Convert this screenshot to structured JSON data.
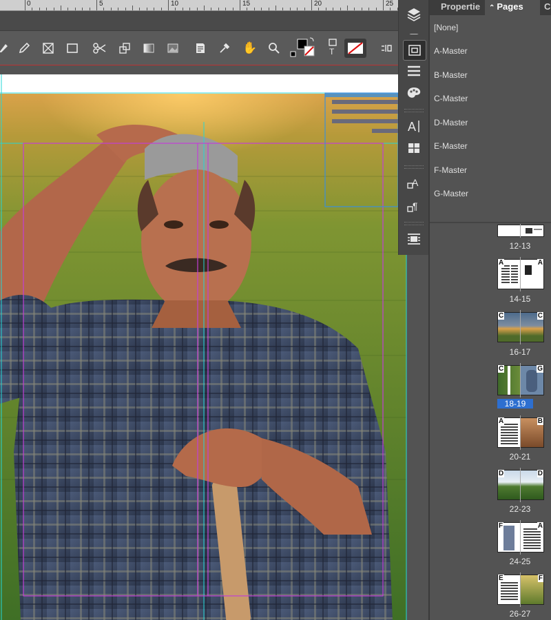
{
  "ruler": {
    "labels": [
      "0",
      "5",
      "10",
      "15",
      "20",
      "25"
    ]
  },
  "toolbar": {
    "tools": [
      "direct-select-icon",
      "pencil-icon",
      "rectangle-frame-icon",
      "rectangle-icon",
      "scissors-icon",
      "free-transform-icon",
      "gradient-swatch-icon",
      "gradient-feather-icon",
      "note-icon",
      "eyedropper-icon",
      "hand-icon",
      "zoom-icon",
      "fill-stroke-icon",
      "format-affects-icon",
      "apply-none-icon",
      "view-mode-icon",
      "screen-mode-icon"
    ]
  },
  "minibar": {
    "icons": [
      "layers-icon",
      "links-icon",
      "stroke-icon",
      "swatches-icon",
      "character-styles-icon",
      "paragraph-table-icon",
      "object-styles-icon",
      "paragraph-styles-icon",
      "text-wrap-icon"
    ]
  },
  "panel": {
    "tabs": [
      "Propertie",
      "Pages",
      "Co"
    ],
    "masters": [
      "[None]",
      "A-Master",
      "B-Master",
      "C-Master",
      "D-Master",
      "E-Master",
      "F-Master",
      "G-Master"
    ],
    "spreads": [
      {
        "label": "12-13",
        "left_master": "",
        "right_master": ""
      },
      {
        "label": "14-15",
        "left_master": "A",
        "right_master": "A"
      },
      {
        "label": "16-17",
        "left_master": "C",
        "right_master": "C"
      },
      {
        "label": "18-19",
        "left_master": "C",
        "right_master": "G",
        "selected": true
      },
      {
        "label": "20-21",
        "left_master": "A",
        "right_master": "B"
      },
      {
        "label": "22-23",
        "left_master": "D",
        "right_master": "D"
      },
      {
        "label": "24-25",
        "left_master": "F",
        "right_master": "A"
      },
      {
        "label": "26-27",
        "left_master": "E",
        "right_master": "F"
      }
    ]
  },
  "colors": {
    "guide_magenta": "#c23fd6",
    "guide_cyan": "#23d7d7",
    "selection_blue": "#2d6fd0",
    "panel_bg": "#535353"
  }
}
